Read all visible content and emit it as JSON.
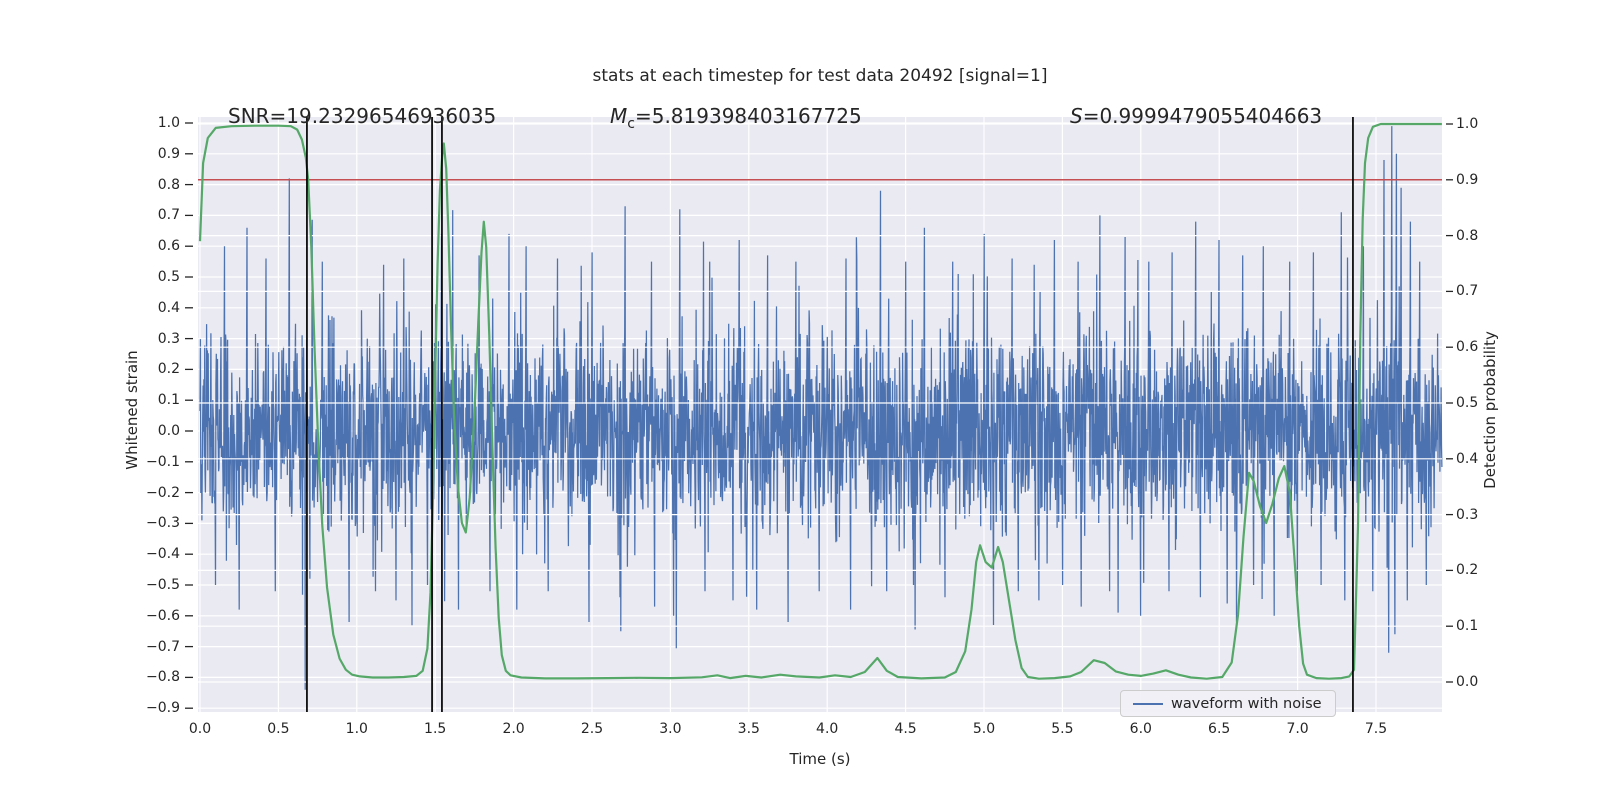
{
  "title": "stats at each timestep for test data 20492 [signal=1]",
  "annotations": {
    "snr": "SNR=19.23296546936035",
    "mc_symbol": "M",
    "mc_sub": "c",
    "mc_value": "=5.819398403167725",
    "s_symbol": "S",
    "s_value": "=0.9999479055404663"
  },
  "axes": {
    "left_label": "Whitened strain",
    "right_label": "Detection probability",
    "x_label": "Time (s)"
  },
  "legend": {
    "label": "waveform with noise"
  },
  "colors": {
    "waveform": "#4c72b0",
    "probability": "#55a868",
    "threshold": "#c44e52",
    "event_marker": "#000000",
    "axes_bg": "#eaeaf2",
    "grid": "#ffffff",
    "text": "#262626"
  },
  "chart_data": {
    "type": "line",
    "title": "stats at each timestep for test data 20492 [signal=1]",
    "xlabel": "Time (s)",
    "x_ticks": [
      0.0,
      0.5,
      1.0,
      1.5,
      2.0,
      2.5,
      3.0,
      3.5,
      4.0,
      4.5,
      5.0,
      5.5,
      6.0,
      6.5,
      7.0,
      7.5
    ],
    "x_tick_labels": [
      "0.0",
      "0.5",
      "1.0",
      "1.5",
      "2.0",
      "2.5",
      "3.0",
      "3.5",
      "4.0",
      "4.5",
      "5.0",
      "5.5",
      "6.0",
      "6.5",
      "7.0",
      "7.5"
    ],
    "xlim": [
      0,
      7.92
    ],
    "left_axis": {
      "label": "Whitened strain",
      "tick_values": [
        1.0,
        0.9,
        0.8,
        0.7,
        0.6,
        0.5,
        0.4,
        0.3,
        0.2,
        0.1,
        0.0,
        -0.1,
        -0.2,
        -0.3,
        -0.4,
        -0.5,
        -0.6,
        -0.7,
        -0.8,
        -0.9
      ],
      "tick_labels": [
        "1.0",
        "0.9",
        "0.8",
        "0.7",
        "0.6",
        "0.5",
        "0.4",
        "0.3",
        "0.2",
        "0.1",
        "0.0",
        "−0.1",
        "−0.2",
        "−0.3",
        "−0.4",
        "−0.5",
        "−0.6",
        "−0.7",
        "−0.8",
        "−0.9"
      ],
      "ylim": [
        -0.912,
        1.019
      ]
    },
    "right_axis": {
      "label": "Detection probability",
      "tick_values": [
        1.0,
        0.9,
        0.8,
        0.7,
        0.6,
        0.5,
        0.4,
        0.3,
        0.2,
        0.1,
        0.0
      ],
      "tick_labels": [
        "1.0",
        "0.9",
        "0.8",
        "0.7",
        "0.6",
        "0.5",
        "0.4",
        "0.3",
        "0.2",
        "0.1",
        "0.0"
      ],
      "ylim": [
        -0.054,
        1.012
      ]
    },
    "grid": true,
    "legend_position": "lower right",
    "threshold_line": {
      "axis": "right",
      "value": 0.9,
      "color": "#c44e52"
    },
    "event_vlines_t": [
      0.682,
      1.48,
      1.543,
      7.353
    ],
    "series": [
      {
        "name": "waveform with noise",
        "axis": "left",
        "color": "#4c72b0",
        "synthetic_noise": {
          "seed": 20492,
          "n": 3200,
          "sigma_core": 0.16,
          "sigma_tail": 0.27,
          "tail_fraction": 0.1,
          "max_abs": 0.84
        },
        "notable_spikes": [
          [
            0.155,
            0.6
          ],
          [
            0.3,
            0.66
          ],
          [
            0.42,
            0.56
          ],
          [
            0.57,
            0.82
          ],
          [
            0.78,
            0.55
          ],
          [
            0.95,
            0.58
          ],
          [
            1.17,
            0.54
          ],
          [
            1.3,
            0.56
          ],
          [
            1.54,
            0.64
          ],
          [
            1.78,
            0.57
          ],
          [
            1.97,
            0.64
          ],
          [
            2.08,
            0.6
          ],
          [
            2.28,
            0.56
          ],
          [
            2.5,
            0.58
          ],
          [
            2.71,
            0.73
          ],
          [
            2.88,
            0.55
          ],
          [
            3.06,
            0.72
          ],
          [
            3.25,
            0.55
          ],
          [
            3.44,
            0.62
          ],
          [
            3.62,
            0.57
          ],
          [
            3.8,
            0.55
          ],
          [
            3.95,
            0.6
          ],
          [
            4.12,
            0.56
          ],
          [
            4.34,
            0.78
          ],
          [
            4.5,
            0.55
          ],
          [
            4.62,
            0.66
          ],
          [
            4.8,
            0.55
          ],
          [
            5.0,
            0.64
          ],
          [
            5.18,
            0.56
          ],
          [
            5.32,
            0.54
          ],
          [
            5.45,
            0.62
          ],
          [
            5.6,
            0.55
          ],
          [
            5.74,
            0.7
          ],
          [
            5.9,
            0.63
          ],
          [
            6.05,
            0.55
          ],
          [
            6.2,
            0.58
          ],
          [
            6.35,
            0.68
          ],
          [
            6.5,
            0.62
          ],
          [
            6.65,
            0.57
          ],
          [
            6.78,
            0.6
          ],
          [
            6.95,
            0.55
          ],
          [
            7.1,
            0.58
          ],
          [
            7.28,
            0.71
          ],
          [
            7.42,
            0.6
          ],
          [
            7.55,
            0.88
          ],
          [
            7.6,
            0.99
          ],
          [
            7.63,
            0.9
          ],
          [
            7.66,
            0.79
          ],
          [
            7.72,
            0.68
          ],
          [
            7.78,
            0.55
          ],
          [
            0.1,
            -0.5
          ],
          [
            0.25,
            -0.58
          ],
          [
            0.48,
            -0.52
          ],
          [
            0.7,
            -0.48
          ],
          [
            0.95,
            -0.62
          ],
          [
            1.12,
            -0.52
          ],
          [
            1.25,
            -0.55
          ],
          [
            1.45,
            -0.5
          ],
          [
            1.65,
            -0.58
          ],
          [
            1.85,
            -0.52
          ],
          [
            2.02,
            -0.58
          ],
          [
            2.22,
            -0.52
          ],
          [
            2.48,
            -0.62
          ],
          [
            2.68,
            -0.54
          ],
          [
            2.9,
            -0.57
          ],
          [
            3.02,
            -0.6
          ],
          [
            3.22,
            -0.52
          ],
          [
            3.4,
            -0.55
          ],
          [
            3.55,
            -0.58
          ],
          [
            3.75,
            -0.62
          ],
          [
            3.95,
            -0.52
          ],
          [
            4.15,
            -0.58
          ],
          [
            4.38,
            -0.52
          ],
          [
            4.55,
            -0.5
          ],
          [
            4.75,
            -0.54
          ],
          [
            5.06,
            -0.63
          ],
          [
            5.22,
            -0.52
          ],
          [
            5.35,
            -0.55
          ],
          [
            5.5,
            -0.5
          ],
          [
            5.62,
            -0.57
          ],
          [
            5.8,
            -0.52
          ],
          [
            6.0,
            -0.6
          ],
          [
            6.18,
            -0.52
          ],
          [
            6.38,
            -0.54
          ],
          [
            6.55,
            -0.56
          ],
          [
            6.72,
            -0.5
          ],
          [
            6.85,
            -0.6
          ],
          [
            7.0,
            -0.52
          ],
          [
            7.15,
            -0.5
          ],
          [
            7.3,
            -0.55
          ],
          [
            7.48,
            -0.52
          ],
          [
            7.58,
            -0.72
          ],
          [
            7.62,
            -0.66
          ],
          [
            7.7,
            -0.55
          ],
          [
            7.82,
            -0.5
          ]
        ]
      },
      {
        "name": "detection probability",
        "axis": "right",
        "color": "#55a868",
        "points": [
          [
            0.0,
            0.79
          ],
          [
            0.02,
            0.93
          ],
          [
            0.05,
            0.975
          ],
          [
            0.1,
            0.993
          ],
          [
            0.2,
            0.996
          ],
          [
            0.35,
            0.997
          ],
          [
            0.5,
            0.997
          ],
          [
            0.58,
            0.996
          ],
          [
            0.62,
            0.99
          ],
          [
            0.65,
            0.972
          ],
          [
            0.675,
            0.94
          ],
          [
            0.69,
            0.9
          ],
          [
            0.71,
            0.78
          ],
          [
            0.73,
            0.6
          ],
          [
            0.755,
            0.42
          ],
          [
            0.78,
            0.28
          ],
          [
            0.81,
            0.17
          ],
          [
            0.85,
            0.085
          ],
          [
            0.89,
            0.042
          ],
          [
            0.93,
            0.022
          ],
          [
            0.97,
            0.013
          ],
          [
            1.02,
            0.01
          ],
          [
            1.1,
            0.008
          ],
          [
            1.2,
            0.008
          ],
          [
            1.3,
            0.009
          ],
          [
            1.38,
            0.011
          ],
          [
            1.42,
            0.02
          ],
          [
            1.45,
            0.06
          ],
          [
            1.47,
            0.16
          ],
          [
            1.485,
            0.32
          ],
          [
            1.5,
            0.55
          ],
          [
            1.515,
            0.75
          ],
          [
            1.53,
            0.88
          ],
          [
            1.545,
            0.945
          ],
          [
            1.555,
            0.965
          ],
          [
            1.57,
            0.92
          ],
          [
            1.585,
            0.8
          ],
          [
            1.6,
            0.645
          ],
          [
            1.62,
            0.48
          ],
          [
            1.645,
            0.35
          ],
          [
            1.67,
            0.285
          ],
          [
            1.695,
            0.268
          ],
          [
            1.72,
            0.33
          ],
          [
            1.75,
            0.48
          ],
          [
            1.775,
            0.645
          ],
          [
            1.795,
            0.77
          ],
          [
            1.81,
            0.825
          ],
          [
            1.825,
            0.78
          ],
          [
            1.845,
            0.62
          ],
          [
            1.865,
            0.42
          ],
          [
            1.885,
            0.24
          ],
          [
            1.905,
            0.115
          ],
          [
            1.925,
            0.048
          ],
          [
            1.95,
            0.02
          ],
          [
            1.98,
            0.012
          ],
          [
            2.05,
            0.008
          ],
          [
            2.2,
            0.0065
          ],
          [
            2.4,
            0.0065
          ],
          [
            2.6,
            0.007
          ],
          [
            2.8,
            0.0075
          ],
          [
            3.0,
            0.007
          ],
          [
            3.2,
            0.0085
          ],
          [
            3.3,
            0.012
          ],
          [
            3.38,
            0.007
          ],
          [
            3.48,
            0.011
          ],
          [
            3.58,
            0.008
          ],
          [
            3.7,
            0.013
          ],
          [
            3.8,
            0.01
          ],
          [
            3.95,
            0.008
          ],
          [
            4.05,
            0.012
          ],
          [
            4.15,
            0.009
          ],
          [
            4.24,
            0.018
          ],
          [
            4.32,
            0.043
          ],
          [
            4.38,
            0.02
          ],
          [
            4.45,
            0.009
          ],
          [
            4.6,
            0.0065
          ],
          [
            4.75,
            0.008
          ],
          [
            4.82,
            0.018
          ],
          [
            4.88,
            0.055
          ],
          [
            4.92,
            0.13
          ],
          [
            4.95,
            0.215
          ],
          [
            4.975,
            0.245
          ],
          [
            5.01,
            0.215
          ],
          [
            5.05,
            0.205
          ],
          [
            5.09,
            0.242
          ],
          [
            5.12,
            0.215
          ],
          [
            5.16,
            0.145
          ],
          [
            5.2,
            0.075
          ],
          [
            5.24,
            0.025
          ],
          [
            5.28,
            0.009
          ],
          [
            5.35,
            0.006
          ],
          [
            5.45,
            0.007
          ],
          [
            5.55,
            0.01
          ],
          [
            5.62,
            0.018
          ],
          [
            5.7,
            0.039
          ],
          [
            5.77,
            0.034
          ],
          [
            5.84,
            0.019
          ],
          [
            5.92,
            0.013
          ],
          [
            6.0,
            0.011
          ],
          [
            6.08,
            0.015
          ],
          [
            6.16,
            0.021
          ],
          [
            6.24,
            0.013
          ],
          [
            6.32,
            0.008
          ],
          [
            6.42,
            0.006
          ],
          [
            6.52,
            0.009
          ],
          [
            6.58,
            0.035
          ],
          [
            6.62,
            0.12
          ],
          [
            6.655,
            0.26
          ],
          [
            6.69,
            0.375
          ],
          [
            6.72,
            0.36
          ],
          [
            6.76,
            0.315
          ],
          [
            6.8,
            0.285
          ],
          [
            6.84,
            0.32
          ],
          [
            6.88,
            0.365
          ],
          [
            6.915,
            0.387
          ],
          [
            6.95,
            0.34
          ],
          [
            6.98,
            0.22
          ],
          [
            7.01,
            0.1
          ],
          [
            7.035,
            0.033
          ],
          [
            7.06,
            0.013
          ],
          [
            7.12,
            0.007
          ],
          [
            7.2,
            0.006
          ],
          [
            7.28,
            0.007
          ],
          [
            7.33,
            0.01
          ],
          [
            7.36,
            0.022
          ],
          [
            7.385,
            0.28
          ],
          [
            7.4,
            0.62
          ],
          [
            7.415,
            0.83
          ],
          [
            7.43,
            0.93
          ],
          [
            7.45,
            0.975
          ],
          [
            7.48,
            0.995
          ],
          [
            7.53,
            1.0
          ],
          [
            7.65,
            1.0
          ],
          [
            7.8,
            1.0
          ],
          [
            7.92,
            1.0
          ]
        ]
      }
    ]
  }
}
